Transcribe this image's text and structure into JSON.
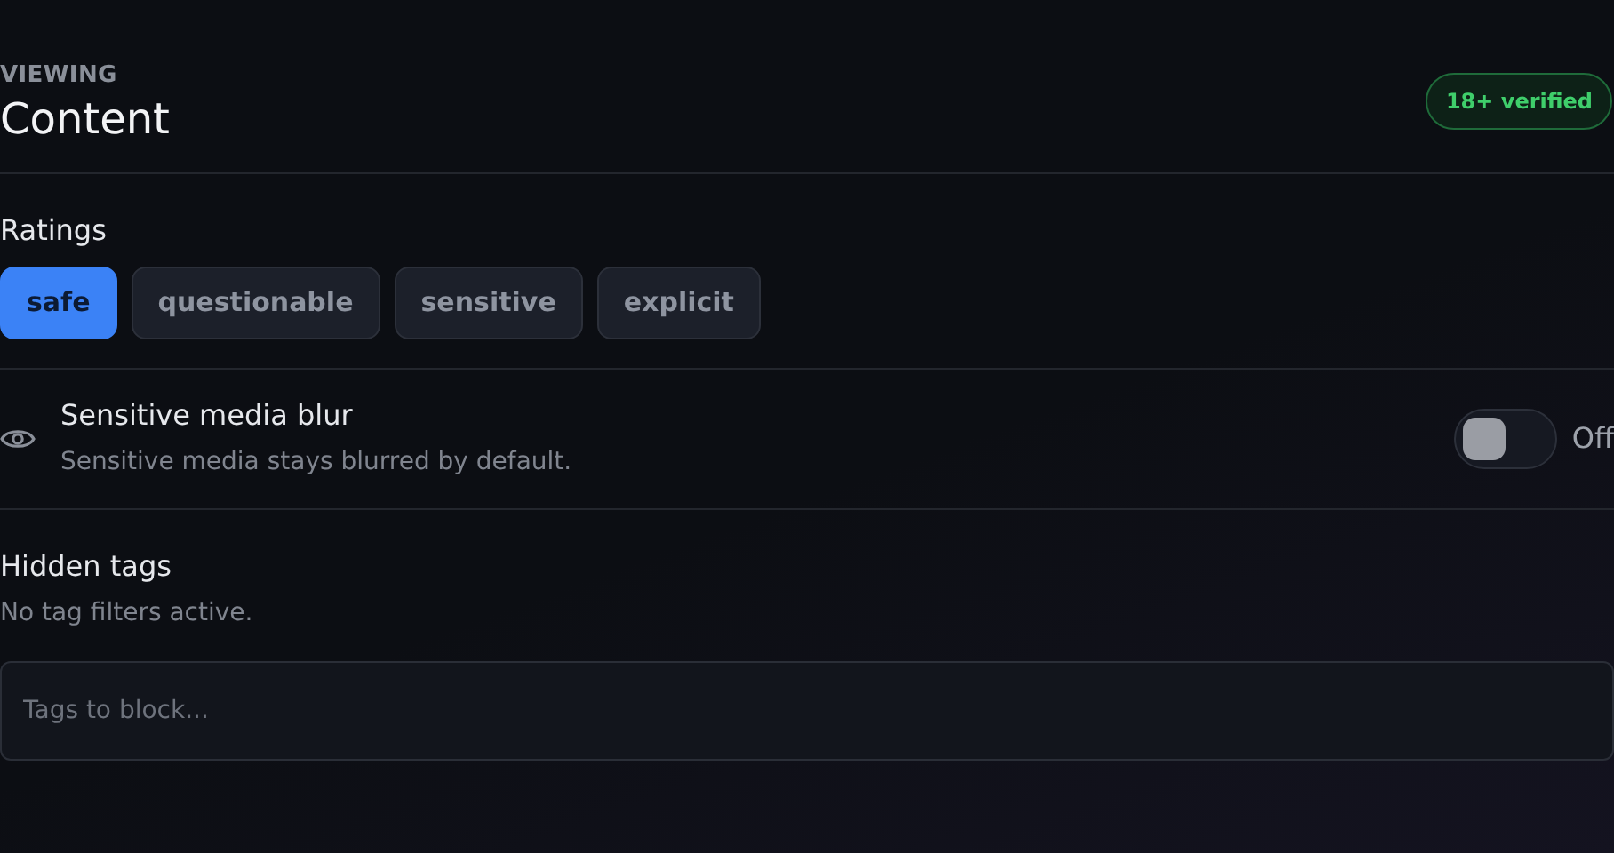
{
  "header": {
    "eyebrow": "VIEWING",
    "title": "Content",
    "badge": "18+ verified"
  },
  "ratings": {
    "label": "Ratings",
    "options": [
      {
        "label": "safe",
        "selected": true
      },
      {
        "label": "questionable",
        "selected": false
      },
      {
        "label": "sensitive",
        "selected": false
      },
      {
        "label": "explicit",
        "selected": false
      }
    ]
  },
  "blur_setting": {
    "title": "Sensitive media blur",
    "description": "Sensitive media stays blurred by default.",
    "on": false,
    "state_label": "Off"
  },
  "hidden_tags": {
    "title": "Hidden tags",
    "status": "No tag filters active.",
    "input": {
      "placeholder": "Tags to block..."
    }
  }
}
